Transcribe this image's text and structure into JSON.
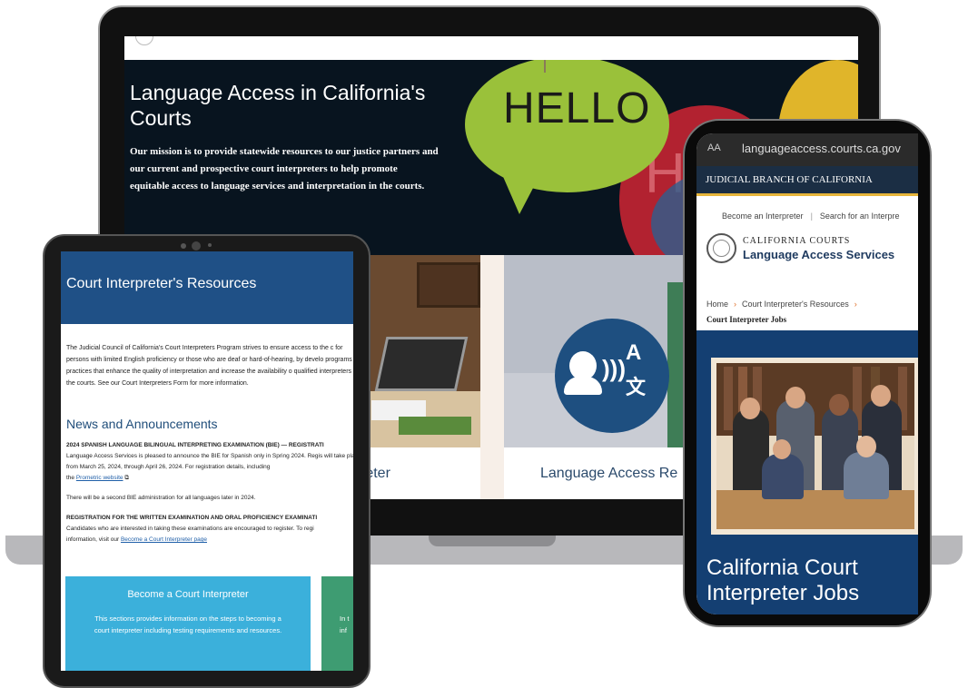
{
  "laptop": {
    "hero_title": "Language Access in California's Courts",
    "hero_text": "Our mission is to provide statewide resources to our justice partners and our current and prospective court interpreters to help promote equitable access to language services and interpretation in the courts.",
    "hello_green": "HELLO",
    "hello_red": "H",
    "card1_label": "reter",
    "card2_label": "Language Access Re",
    "accent_navy": "#08141f"
  },
  "tablet": {
    "header_title": "Court Interpreter's Resources",
    "intro": "The Judicial Council of California's Court Interpreters Program strives to ensure access to the c for persons with limited English proficiency or those who are deaf or hard-of-hearing, by develo programs and practices that enhance the quality of interpretation and increase the availability o qualified interpreters in the courts. See our Court Interpreters Form for more information.",
    "news_title": "News and Announcements",
    "item1_heading": "2024 SPANISH LANGUAGE BILINGUAL INTERPRETING EXAMINATION (BIE) — REGISTRATI",
    "item1_body": "Language Access Services is pleased to announce the BIE for Spanish only in Spring 2024. Regis will take place from March 25, 2024, through April 26, 2024. For registration details, including",
    "item1_link_prefix": "the ",
    "item1_link": "Prometric website",
    "item2_body": "There will be a second BIE administration for all languages later in 2024.",
    "item3_heading": "REGISTRATION FOR THE WRITTEN EXAMINATION AND ORAL PROFICIENCY EXAMINATI",
    "item3_body": "Candidates who are interested in taking these examinations are encouraged to register. To regi",
    "item3_link_prefix": "information, visit our ",
    "item3_link": "Become a Court Interpreter page",
    "cta_title": "Become a Court Interpreter",
    "cta_text": "This sections provides information on the steps to becoming a court interpreter including testing requirements and resources.",
    "cta2_line1": "In t",
    "cta2_line2": "inf",
    "header_color": "#1f5086",
    "cta_color": "#3bb0db"
  },
  "phone": {
    "aa": "AA",
    "url": "languageaccess.courts.ca.gov",
    "judicial_branch": "JUDICIAL BRANCH OF CALIFORNIA",
    "link_become": "Become an Interpreter",
    "link_search": "Search for an Interpre",
    "california_courts": "CALIFORNIA COURTS",
    "language_access_services": "Language Access Services",
    "crumb_home": "Home",
    "crumb_resources": "Court Interpreter's Resources",
    "crumb_current": "Court Interpreter Jobs",
    "hero_title": "California Court Interpreter Jobs",
    "hero_color": "#143f72",
    "gold_accent": "#e6b53a"
  }
}
